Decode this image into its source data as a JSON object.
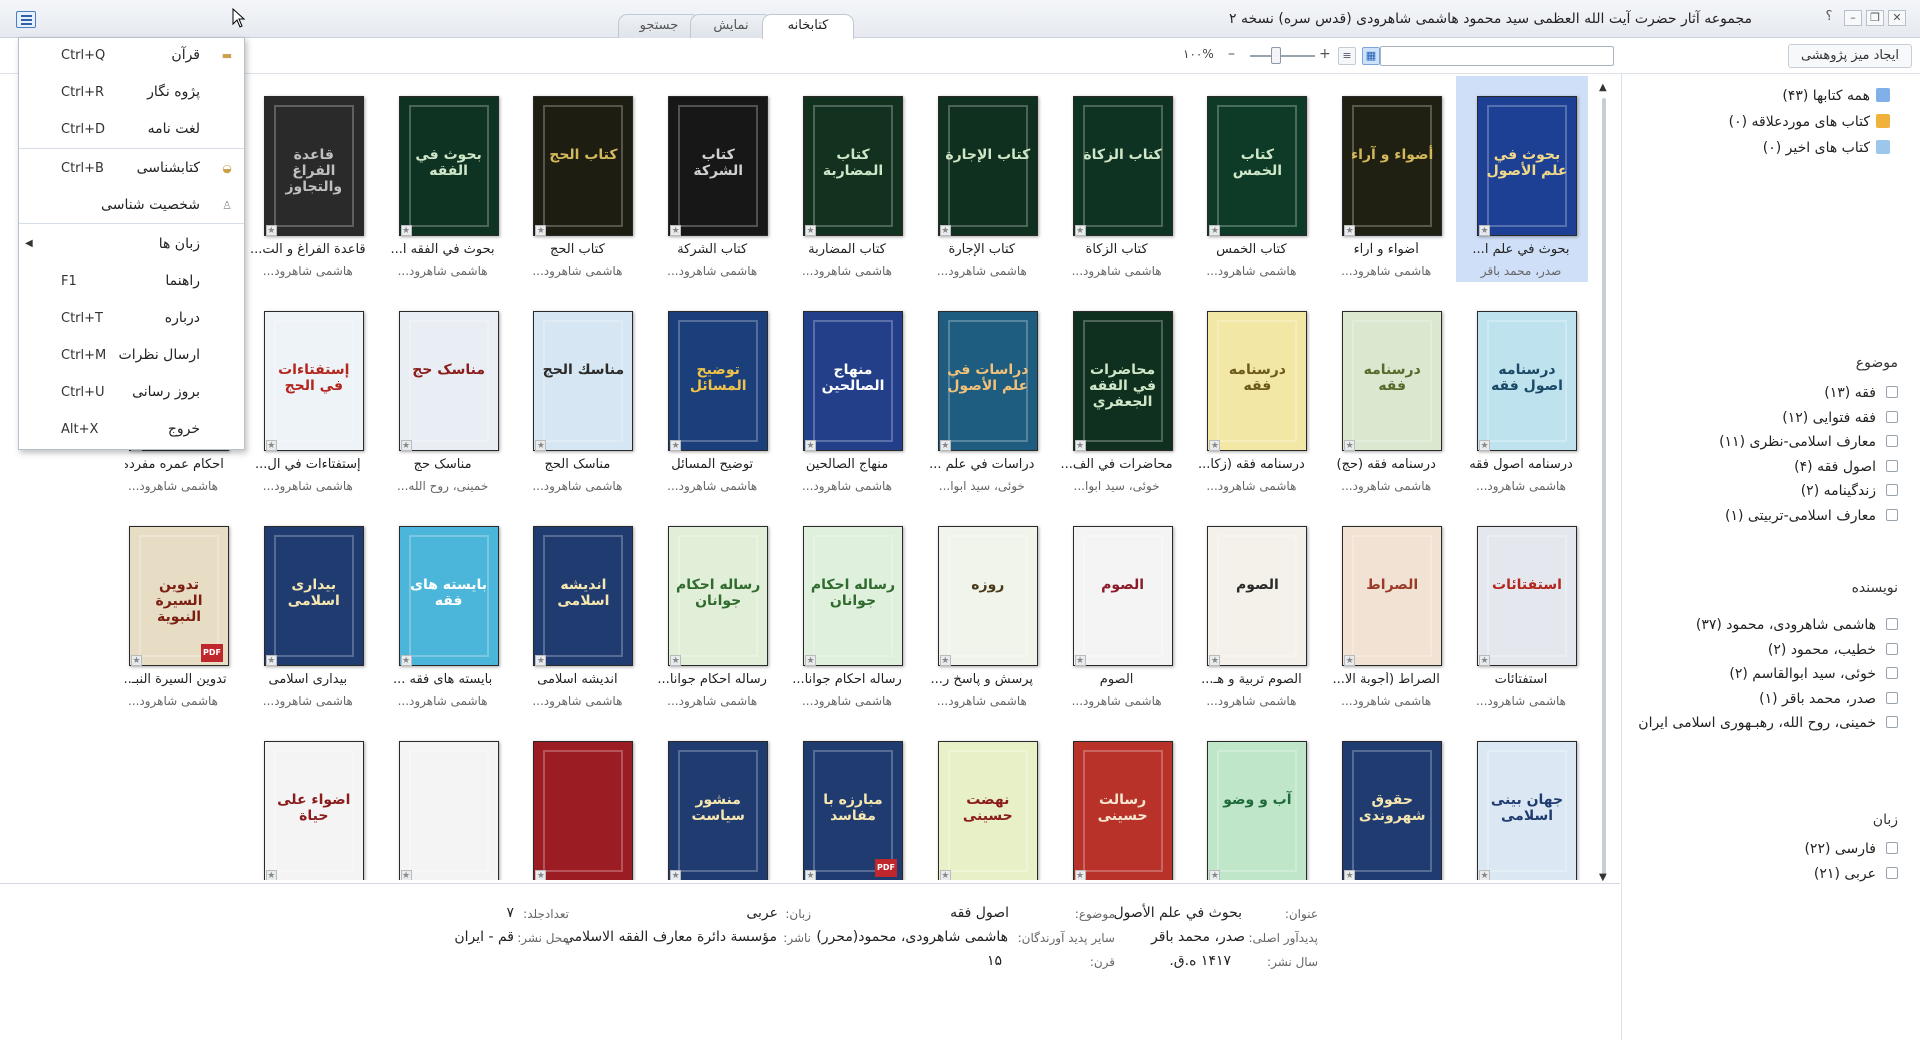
{
  "window": {
    "title": "مجموعه آثار حضرت آیت الله العظمی سید محمود هاشمی شاهرودی (قدس سره) نسخه ۲",
    "help": "؟"
  },
  "tabs": [
    {
      "label": "کتابخانه"
    },
    {
      "label": "نمایش"
    },
    {
      "label": "جستجو"
    }
  ],
  "toolbar": {
    "research_label": "ایجاد میز پژوهشی",
    "search_placeholder": "",
    "zoom": "۱۰۰%",
    "zoom_level": 0.35
  },
  "menu": {
    "items": [
      {
        "label": "قرآن",
        "shortcut": "Ctrl+Q",
        "icon": "quran-icon"
      },
      {
        "label": "پژوه نگار",
        "shortcut": "Ctrl+R",
        "icon": ""
      },
      {
        "label": "لغت نامه",
        "shortcut": "Ctrl+D",
        "icon": ""
      },
      {
        "label": "کتابشناسی",
        "shortcut": "Ctrl+B",
        "icon": "bibliography-icon"
      },
      {
        "label": "شخصیت شناسی",
        "shortcut": "",
        "icon": "person-icon"
      },
      {
        "label": "زبان ها",
        "shortcut": "",
        "icon": ""
      },
      {
        "label": "راهنما",
        "shortcut": "F1",
        "icon": ""
      },
      {
        "label": "درباره",
        "shortcut": "Ctrl+T",
        "icon": ""
      },
      {
        "label": "ارسال نظرات",
        "shortcut": "Ctrl+M",
        "icon": ""
      },
      {
        "label": "بروز رسانی",
        "shortcut": "Ctrl+U",
        "icon": ""
      },
      {
        "label": "خروج",
        "shortcut": "Alt+X",
        "icon": ""
      }
    ]
  },
  "books": [
    {
      "title": "بحوث في علم ا...",
      "author": "صدر، محمد باقر",
      "cover_title": "بحوث في علم الأصول",
      "bg": "#1d3f94",
      "fg": "#f1d98a",
      "selected": true,
      "pdf": false
    },
    {
      "title": "أضواء و آراء",
      "author": "هاشمی شاهرود...",
      "cover_title": "أضواء و آراء",
      "bg": "#1f1f12",
      "fg": "#d4b95c",
      "pdf": false
    },
    {
      "title": "كتاب الخمس",
      "author": "هاشمی شاهرود...",
      "cover_title": "كتاب الخمس",
      "bg": "#0e3b27",
      "fg": "#cfe6c8",
      "pdf": false
    },
    {
      "title": "كتاب الزكاة",
      "author": "هاشمی شاهرود...",
      "cover_title": "كتاب الزكاة",
      "bg": "#0f3322",
      "fg": "#cfe6c8",
      "pdf": false
    },
    {
      "title": "كتاب الإجارة",
      "author": "هاشمی شاهرود...",
      "cover_title": "كتاب الإجارة",
      "bg": "#10301f",
      "fg": "#cfe6c8",
      "pdf": false
    },
    {
      "title": "كتاب المضاربة",
      "author": "هاشمی شاهرود...",
      "cover_title": "كتاب المضاربة",
      "bg": "#12321f",
      "fg": "#cfe6c8",
      "pdf": false
    },
    {
      "title": "كتاب الشركة",
      "author": "هاشمی شاهرود...",
      "cover_title": "كتاب الشركة",
      "bg": "#171717",
      "fg": "#d0d0d0",
      "pdf": false
    },
    {
      "title": "كتاب الحج",
      "author": "هاشمی شاهرود...",
      "cover_title": "كتاب الحج",
      "bg": "#1d1d12",
      "fg": "#d4b95c",
      "pdf": false
    },
    {
      "title": "بحوث في الفقه ا...",
      "author": "هاشمی شاهرود...",
      "cover_title": "بحوث في الفقه",
      "bg": "#0f3322",
      "fg": "#cfe6c8",
      "pdf": false
    },
    {
      "title": "قاعدة الفراغ و الت...",
      "author": "هاشمی شاهرود...",
      "cover_title": "قاعدة الفراغ والتجاوز",
      "bg": "#2a2a2a",
      "fg": "#bfbfbf",
      "pdf": false
    },
    {
      "title": "درسنامه اصول فقه",
      "author": "هاشمی شاهرود...",
      "cover_title": "درسنامه اصول فقه",
      "bg": "#bfe3ee",
      "fg": "#1b4a66",
      "pdf": false
    },
    {
      "title": "درسنامه فقه (حج)",
      "author": "هاشمی شاهرود...",
      "cover_title": "درسنامه فقه",
      "bg": "#d9e8cf",
      "fg": "#5a6a2a",
      "pdf": false
    },
    {
      "title": "درسنامه فقه (زکا...",
      "author": "هاشمی شاهرود...",
      "cover_title": "درسنامه فقه",
      "bg": "#f2e7a4",
      "fg": "#6b5a1a",
      "pdf": false
    },
    {
      "title": "محاضرات في الف...",
      "author": "خوئی، سید ابوا...",
      "cover_title": "محاضرات في الفقه الجعفري",
      "bg": "#10301f",
      "fg": "#cfe6c8",
      "pdf": false
    },
    {
      "title": "دراسات في علم ...",
      "author": "خوئی، سید ابوا...",
      "cover_title": "دراسات في علم الأصول",
      "bg": "#1e5c80",
      "fg": "#f2c27a",
      "pdf": false
    },
    {
      "title": "منهاج الصالحين",
      "author": "هاشمی شاهرود...",
      "cover_title": "منهاج الصالحين",
      "bg": "#233f8a",
      "fg": "#ffffff",
      "pdf": false
    },
    {
      "title": "توضيح المسائل",
      "author": "هاشمی شاهرود...",
      "cover_title": "توضيح المسائل",
      "bg": "#1b3f7a",
      "fg": "#f0c24a",
      "pdf": false
    },
    {
      "title": "مناسک الحج",
      "author": "هاشمی شاهرود...",
      "cover_title": "مناسك الحج",
      "bg": "#d6e6f2",
      "fg": "#2b2b2b",
      "pdf": false
    },
    {
      "title": "مناسک حج",
      "author": "خمینی، روح الله...",
      "cover_title": "مناسک حج",
      "bg": "#e9eef4",
      "fg": "#8a1c1c",
      "pdf": false
    },
    {
      "title": "إستفتاءات في ال...",
      "author": "هاشمی شاهرود...",
      "cover_title": "إستفتاءات في الحج",
      "bg": "#eef3f8",
      "fg": "#b3261e",
      "pdf": false
    },
    {
      "title": "احکام عمره مفرده",
      "author": "هاشمی شاهرود...",
      "cover_title": "",
      "bg": "#ffffff",
      "fg": "#333333",
      "pdf": false
    },
    {
      "title": "استفتائات",
      "author": "هاشمی شاهرود...",
      "cover_title": "استفتائات",
      "bg": "#e4e8ee",
      "fg": "#b3261e",
      "pdf": false
    },
    {
      "title": "الصراط (أجوبة الا...",
      "author": "هاشمی شاهرود...",
      "cover_title": "الصراط",
      "bg": "#f1e2d4",
      "fg": "#9a3b2a",
      "pdf": false
    },
    {
      "title": "الصوم تربية و هـ...",
      "author": "هاشمی شاهرود...",
      "cover_title": "الصوم",
      "bg": "#f4f1ea",
      "fg": "#2a2a2a",
      "pdf": false
    },
    {
      "title": "الصوم",
      "author": "هاشمی شاهرود...",
      "cover_title": "الصوم",
      "bg": "#f4f4f4",
      "fg": "#8a1c2a",
      "pdf": false
    },
    {
      "title": "پرسش و پاسخ ر...",
      "author": "هاشمی شاهرود...",
      "cover_title": "روزه",
      "bg": "#f0f4ea",
      "fg": "#4a3a1a",
      "pdf": false
    },
    {
      "title": "رساله احکام جوانا...",
      "author": "هاشمی شاهرود...",
      "cover_title": "رساله احکام جوانان",
      "bg": "#dff0dc",
      "fg": "#2f6a2f",
      "pdf": false
    },
    {
      "title": "رساله احکام جوانا...",
      "author": "هاشمی شاهرود...",
      "cover_title": "رساله احکام جوانان",
      "bg": "#e2efd8",
      "fg": "#2f6a2f",
      "pdf": false
    },
    {
      "title": "انديشه اسلامی",
      "author": "هاشمی شاهرود...",
      "cover_title": "انديشه اسلامی",
      "bg": "#1f3b70",
      "fg": "#f6e7b0",
      "pdf": false
    },
    {
      "title": "بايسته های فقه ...",
      "author": "هاشمی شاهرود...",
      "cover_title": "بایسته های فقه",
      "bg": "#4bb6d9",
      "fg": "#ffffff",
      "pdf": false
    },
    {
      "title": "بيداری اسلامی",
      "author": "هاشمی شاهرود...",
      "cover_title": "بيداری اسلامی",
      "bg": "#1f3b70",
      "fg": "#f6e7b0",
      "pdf": false
    },
    {
      "title": "تدوين السيرة النبـ...",
      "author": "هاشمی شاهرود...",
      "cover_title": "تدوين السيرة النبوية",
      "bg": "#e7dcc4",
      "fg": "#7a1f12",
      "pdf": true
    },
    {
      "title": "",
      "author": "",
      "cover_title": "جهان بینی اسلامی",
      "bg": "#dbe8f3",
      "fg": "#1f3b70",
      "pdf": false
    },
    {
      "title": "",
      "author": "",
      "cover_title": "حقوق شهروندی",
      "bg": "#1f3b70",
      "fg": "#f6e7b0",
      "pdf": false
    },
    {
      "title": "",
      "author": "",
      "cover_title": "آب و وضو",
      "bg": "#bfe6c8",
      "fg": "#1f6a3a",
      "pdf": false
    },
    {
      "title": "",
      "author": "",
      "cover_title": "رسالت حسینی",
      "bg": "#b8322a",
      "fg": "#f5e6d0",
      "pdf": false
    },
    {
      "title": "",
      "author": "",
      "cover_title": "نهضت حسینی",
      "bg": "#e8f0c8",
      "fg": "#8a1c1c",
      "pdf": false
    },
    {
      "title": "",
      "author": "",
      "cover_title": "مبارزه با مفاسد",
      "bg": "#1f3b70",
      "fg": "#f6e7b0",
      "pdf": true
    },
    {
      "title": "",
      "author": "",
      "cover_title": "منشور سیاست",
      "bg": "#1f3b70",
      "fg": "#f6e7b0",
      "pdf": false
    },
    {
      "title": "",
      "author": "",
      "cover_title": "",
      "bg": "#9c1c24",
      "fg": "#f6e7b0",
      "pdf": false
    },
    {
      "title": "",
      "author": "",
      "cover_title": "",
      "bg": "#f4f4f4",
      "fg": "#8a1c1c",
      "pdf": false
    },
    {
      "title": "",
      "author": "",
      "cover_title": "اضواء علی حیاة",
      "bg": "#f4f4f4",
      "fg": "#8a1c1c",
      "pdf": false
    }
  ],
  "sidebar": {
    "library": [
      {
        "label": "همه کتابها (۴۳)",
        "color": "#7fb0e8"
      },
      {
        "label": "کتاب های موردعلاقه (۰)",
        "color": "#f0b23a"
      },
      {
        "label": "کتاب های اخیر (۰)",
        "color": "#9cc6ea"
      }
    ],
    "subject_title": "موضوع",
    "subjects": [
      "فقه (۱۳)",
      "فقه فتوایی (۱۲)",
      "معارف اسلامی-نظری (۱۱)",
      "اصول فقه (۴)",
      "زندگینامه (۲)",
      "معارف اسلامی-تربیتی (۱)"
    ],
    "author_title": "نویسنده",
    "authors": [
      "هاشمی شاهرودی، محمود (۳۷)",
      "خطیب، محمود (۲)",
      "خوئی، سید ابوالقاسم (۲)",
      "صدر، محمد باقر (۱)",
      "خمینی، روح الله، رهبـهوری اسلامی ایران"
    ],
    "language_title": "زبان",
    "languages": [
      "فارسی (۲۲)",
      "عربی (۲۱)"
    ]
  },
  "details": {
    "title_label": "عنوان:",
    "title_value": "بحوث في علم الأصول",
    "subject_label": "موضوع:",
    "subject_value": "اصول فقه",
    "language_label": "زبان:",
    "language_value": "عربی",
    "volumes_label": "تعدادجلد:",
    "volumes_value": "۷",
    "author_label": "پدیدآور اصلی:",
    "author_value": "صدر، محمد باقر",
    "other_label": "سایر پدید آورندگان:",
    "other_value": "هاشمی شاهرودی، محمود(محرر)",
    "publisher_label": "ناشر:",
    "publisher_value": "مؤسسة دائرة معارف الفقه الاسلامي",
    "place_label": "محل نشر:",
    "place_value": "قم - ایران",
    "year_label": "سال نشر:",
    "year_value": "۱۴۱۷ ه.ق.",
    "century_label": "قرن:",
    "century_value": "۱۵"
  }
}
